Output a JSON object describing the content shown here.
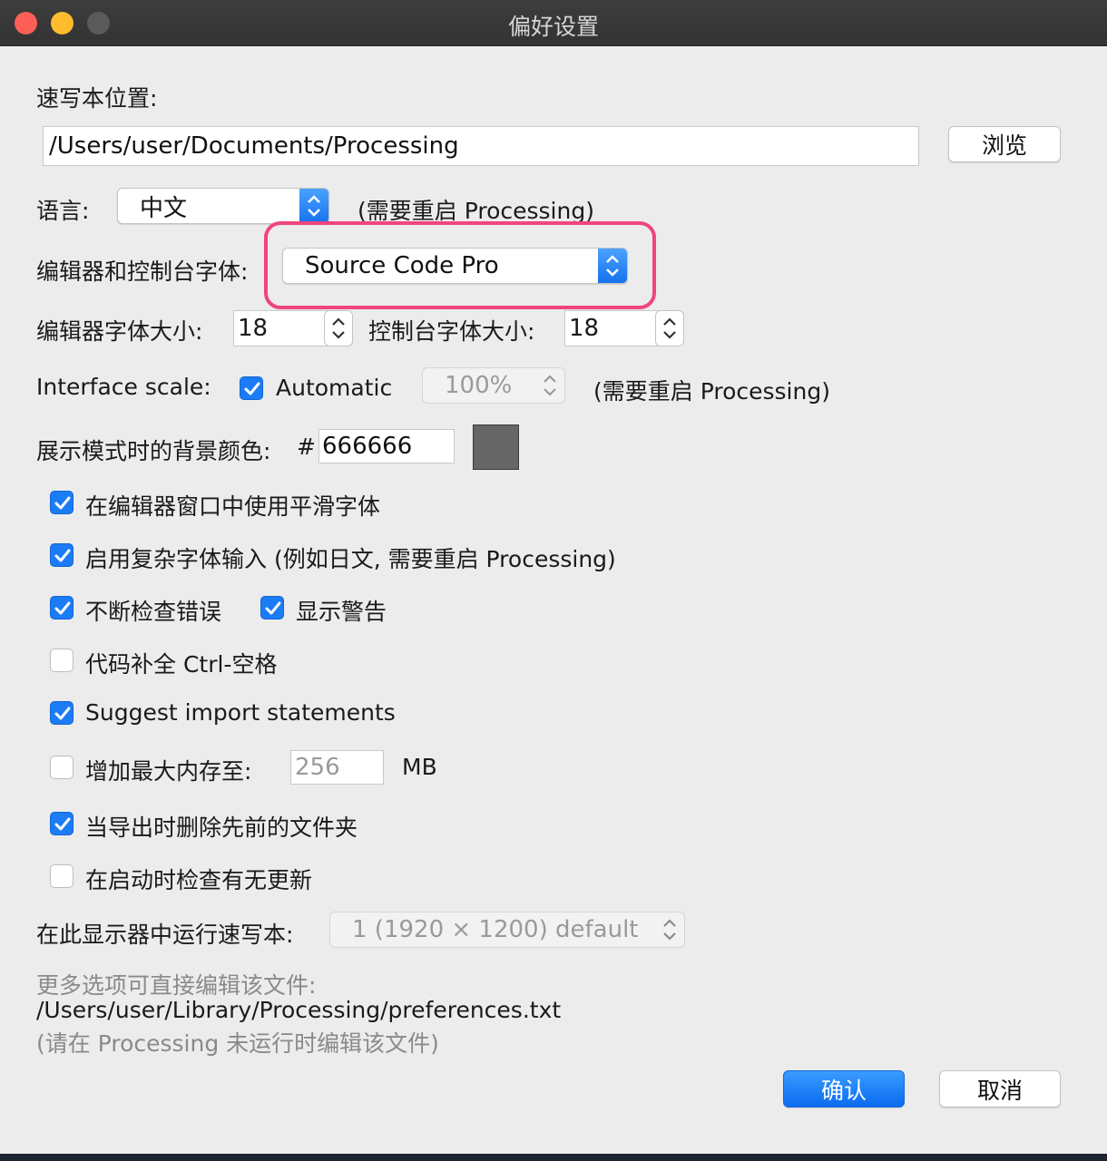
{
  "window": {
    "title": "偏好设置"
  },
  "sketchbook": {
    "label": "速写本位置:",
    "path": "/Users/user/Documents/Processing",
    "browse_button": "浏览"
  },
  "language": {
    "label": "语言:",
    "selected": "中文",
    "note": "(需要重启 Processing)"
  },
  "editor_font": {
    "label": "编辑器和控制台字体:",
    "selected": "Source Code Pro"
  },
  "font_sizes": {
    "editor_label": "编辑器字体大小:",
    "editor_value": "18",
    "console_label": "控制台字体大小:",
    "console_value": "18"
  },
  "interface_scale": {
    "label": "Interface scale:",
    "automatic_label": "Automatic",
    "automatic_checked": true,
    "scale_value": "100%",
    "note": "(需要重启 Processing)"
  },
  "presentation": {
    "label": "展示模式时的背景颜色:",
    "hash": "#",
    "color_value": "666666",
    "swatch_color": "#666666"
  },
  "options": {
    "smooth_fonts": "在编辑器窗口中使用平滑字体",
    "complex_input": "启用复杂字体输入 (例如日文, 需要重启 Processing)",
    "continuous_check": "不断检查错误",
    "show_warnings": "显示警告",
    "code_completion": "代码补全 Ctrl-空格",
    "suggest_imports": "Suggest import statements",
    "increase_memory": "增加最大内存至:",
    "memory_value": "256",
    "memory_unit": "MB",
    "delete_previous": "当导出时删除先前的文件夹",
    "check_updates": "在启动时检查有无更新"
  },
  "display": {
    "label": "在此显示器中运行速写本:",
    "selected": "1 (1920 × 1200) default"
  },
  "footer": {
    "more_options": "更多选项可直接编辑该文件:",
    "prefs_path": "/Users/user/Library/Processing/preferences.txt",
    "hint": "(请在 Processing 未运行时编辑该文件)"
  },
  "buttons": {
    "ok": "确认",
    "cancel": "取消"
  },
  "colors": {
    "accent": "#1b7cf5",
    "highlight": "#f0457d"
  }
}
